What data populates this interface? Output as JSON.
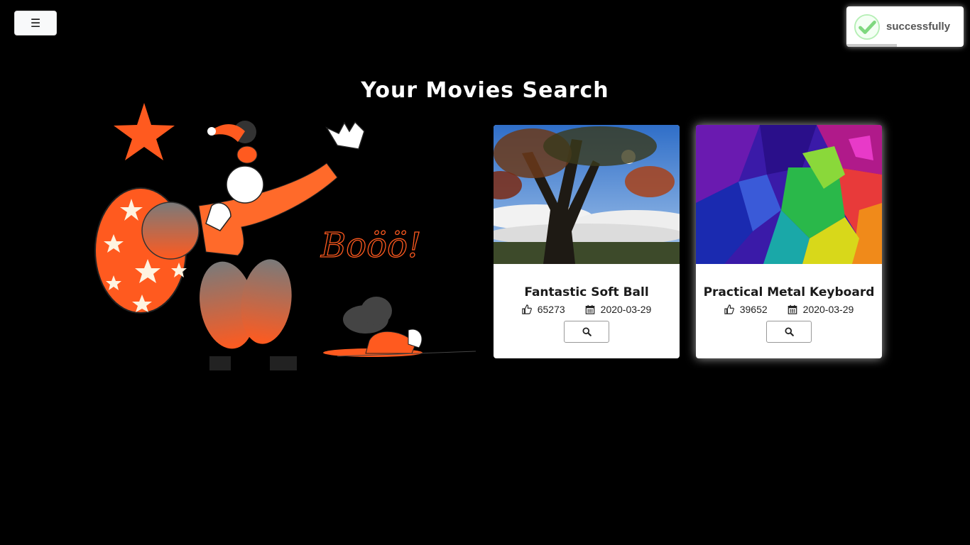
{
  "header": {
    "menu_label": "☰"
  },
  "toast": {
    "message": "successfully",
    "icon": "check-circle-icon",
    "accent": "#9be39b",
    "progress": 0.43
  },
  "page": {
    "title": "Your Movies Search"
  },
  "hero": {
    "booo_text": "Boöö!",
    "accent": "#ff5a1f"
  },
  "movies": [
    {
      "title": "Fantastic Soft Ball",
      "likes": "65273",
      "date": "2020-03-29",
      "image": "tree-sky-photo"
    },
    {
      "title": "Practical Metal Keyboard",
      "likes": "39652",
      "date": "2020-03-29",
      "image": "abstract-colors-photo"
    }
  ]
}
